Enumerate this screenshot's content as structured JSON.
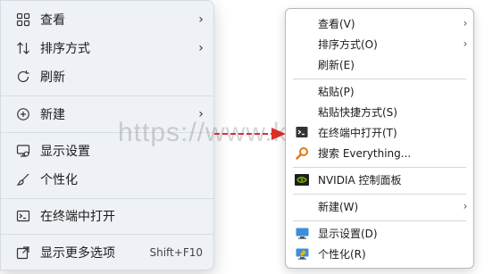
{
  "win11_menu": {
    "view": "查看",
    "sort": "排序方式",
    "refresh": "刷新",
    "new": "新建",
    "display": "显示设置",
    "personalize": "个性化",
    "open_terminal": "在终端中打开",
    "more_options": "显示更多选项",
    "more_options_shortcut": "Shift+F10"
  },
  "watermark": "https://www.kyld.com",
  "classic_menu": {
    "view": "查看(V)",
    "sort": "排序方式(O)",
    "refresh": "刷新(E)",
    "paste": "粘贴(P)",
    "paste_shortcut": "粘贴快捷方式(S)",
    "open_terminal": "在终端中打开(T)",
    "search_everything": "搜索 Everything...",
    "nvidia": "NVIDIA 控制面板",
    "new": "新建(W)",
    "display": "显示设置(D)",
    "personalize": "个性化(R)"
  },
  "colors": {
    "arrow": "#d9302c",
    "nvidia": "#76b900"
  }
}
